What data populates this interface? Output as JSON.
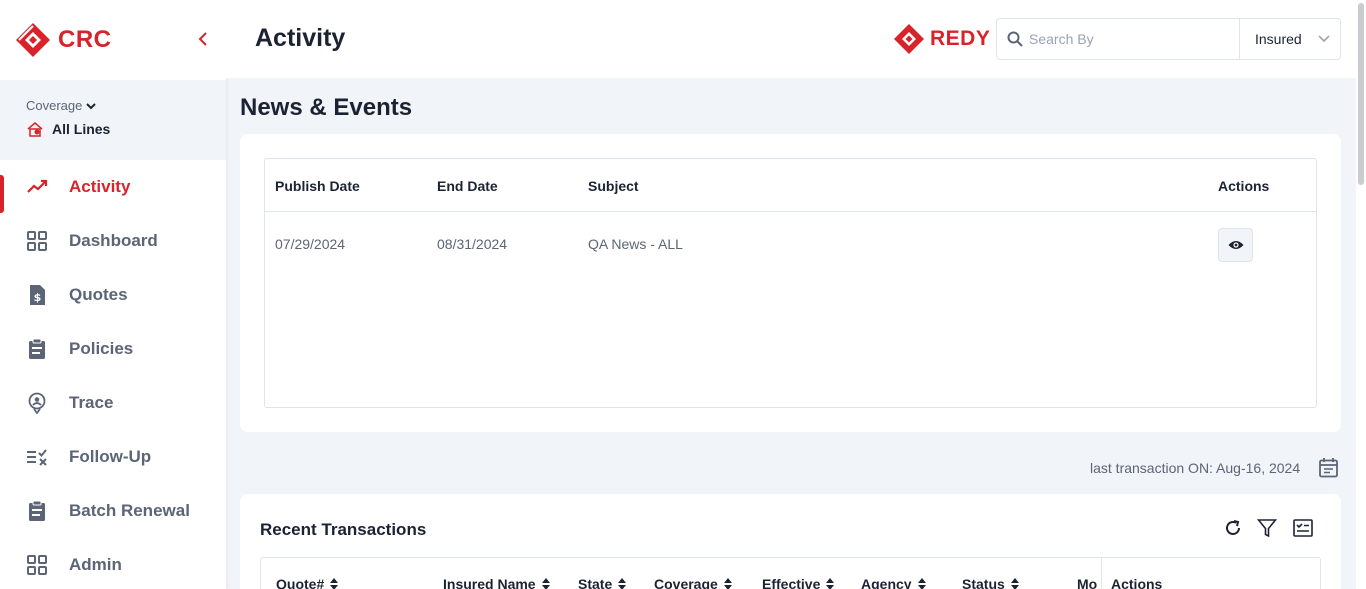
{
  "brand": {
    "name": "CRC"
  },
  "coverage": {
    "label": "Coverage",
    "value": "All Lines"
  },
  "nav": [
    {
      "label": "Activity",
      "icon": "trend-up-icon",
      "active": true
    },
    {
      "label": "Dashboard",
      "icon": "grid-icon"
    },
    {
      "label": "Quotes",
      "icon": "quote-doc-icon"
    },
    {
      "label": "Policies",
      "icon": "clipboard-icon"
    },
    {
      "label": "Trace",
      "icon": "location-pin-icon"
    },
    {
      "label": "Follow-Up",
      "icon": "list-check-icon"
    },
    {
      "label": "Batch Renewal",
      "icon": "clipboard-icon"
    },
    {
      "label": "Admin",
      "icon": "grid-icon"
    }
  ],
  "header": {
    "title": "Activity",
    "partner_logo": "REDY",
    "search_placeholder": "Search By",
    "search_scope": "Insured"
  },
  "news": {
    "title": "News & Events",
    "columns": [
      "Publish Date",
      "End Date",
      "Subject",
      "Actions"
    ],
    "rows": [
      {
        "publish_date": "07/29/2024",
        "end_date": "08/31/2024",
        "subject": "QA News - ALL"
      }
    ]
  },
  "last_transaction": "last transaction ON: Aug-16, 2024",
  "recent": {
    "title": "Recent Transactions",
    "columns": [
      "Quote#",
      "Insured Name",
      "State",
      "Coverage",
      "Effective",
      "Agency",
      "Status",
      "Mo",
      "Actions"
    ]
  },
  "colors": {
    "brand_red": "#d9232a",
    "text_dark": "#1b2333",
    "text_muted": "#5b6576",
    "page_bg": "#f1f4f9"
  }
}
